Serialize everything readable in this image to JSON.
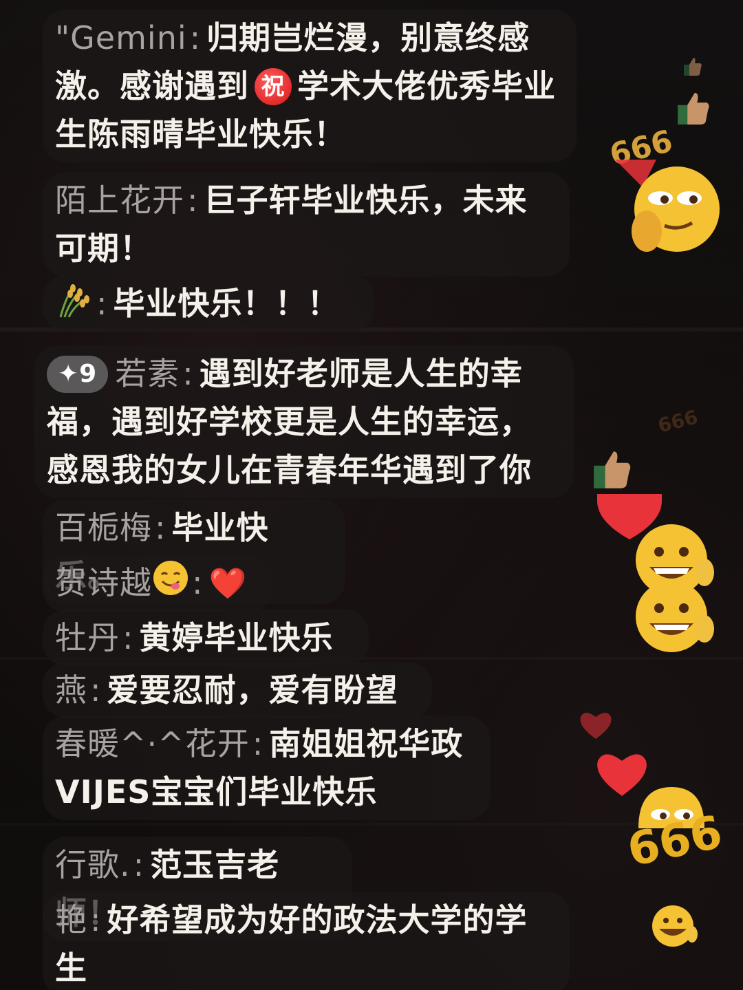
{
  "comments": [
    {
      "name": "\"Gemini",
      "sep": ":",
      "text_a": "归期岂烂漫，别意终感激。感谢遇到",
      "badge": "祝",
      "text_b": "学术大佬优秀毕业生陈雨晴毕业快乐！"
    },
    {
      "name": "陌上花开",
      "sep": ":",
      "text": "巨子轩毕业快乐，未来可期！"
    },
    {
      "name_icon": "rice-icon",
      "sep": ":",
      "text": "毕业快乐！！！"
    },
    {
      "level": "✦9",
      "name": "若素",
      "sep": ":",
      "text": "遇到好老师是人生的幸福，遇到好学校更是人生的幸运，感恩我的女儿在青春年华遇到了你"
    },
    {
      "name": "百栀梅",
      "sep": ":",
      "text": "毕业快乐。"
    },
    {
      "name": "贺诗越",
      "sep": ":",
      "text": "❤️"
    },
    {
      "name": "牡丹",
      "sep": ":",
      "text": "黄婷毕业快乐"
    },
    {
      "name": "燕",
      "sep": ":",
      "text": "爱要忍耐，爱有盼望"
    },
    {
      "name": "春暖^·^花开",
      "sep": ":",
      "text_a": "南姐姐祝华政",
      "text_b": "VIJES宝宝们毕业快乐"
    },
    {
      "name": "行歌.",
      "sep": ":",
      "text": "范玉吉老师！"
    },
    {
      "name": "艳",
      "sep": ":",
      "text_a": "好希望成为好的政法大学的学",
      "text_b": "生"
    }
  ],
  "reactions": {
    "count_label": "666",
    "heart_color": "#e8333a",
    "face_color": "#f5c233"
  }
}
